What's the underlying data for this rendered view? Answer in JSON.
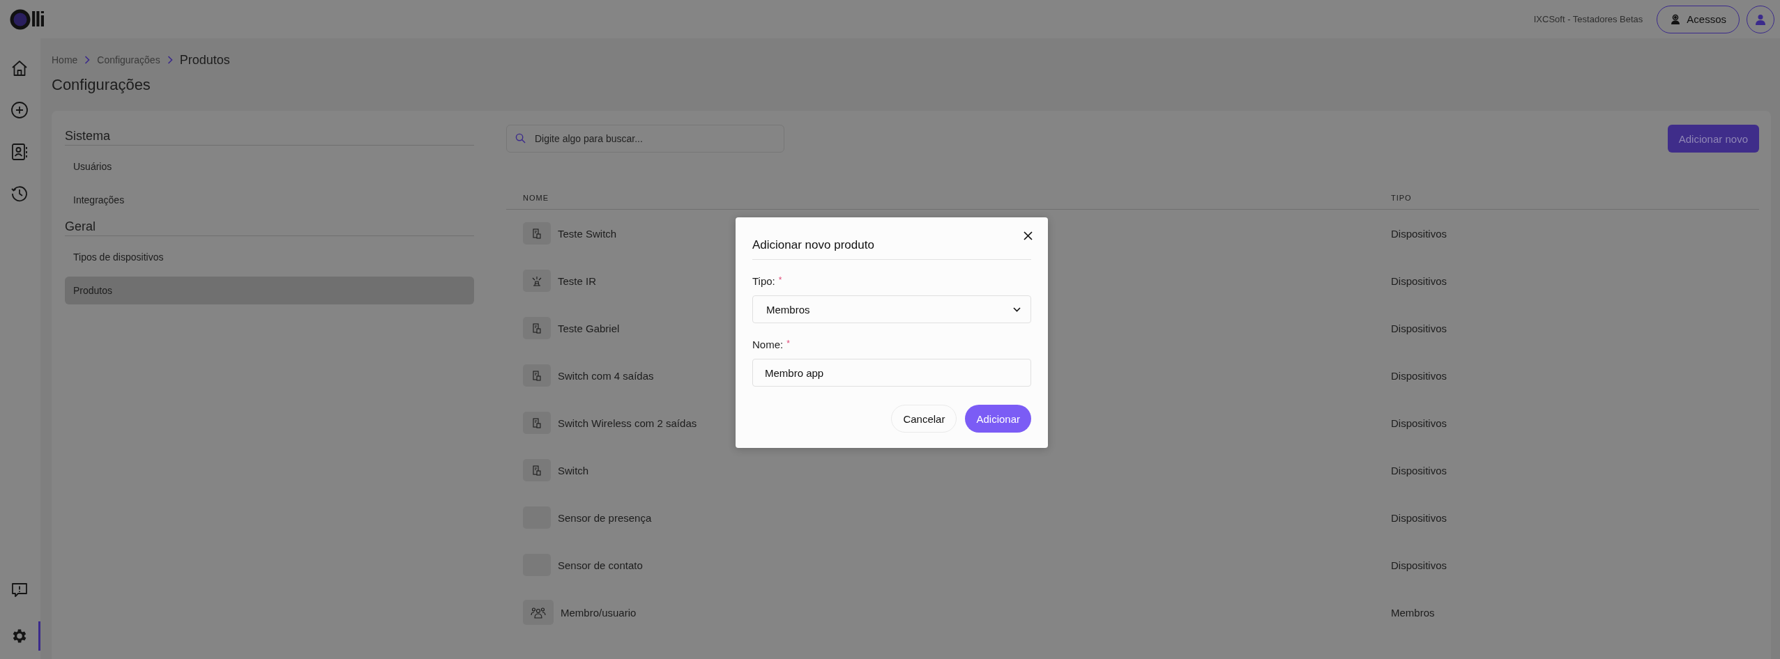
{
  "logo": "lli",
  "top_bar": {
    "organization": "IXCSoft - Testadores Betas",
    "access_button": "Acessos"
  },
  "rail": [
    {
      "kind": "home",
      "selected": false
    },
    {
      "kind": "add",
      "selected": false
    },
    {
      "kind": "contacts",
      "selected": false
    },
    {
      "kind": "history",
      "selected": false
    },
    {
      "kind": "feedback",
      "selected": false
    },
    {
      "kind": "settings",
      "selected": true
    }
  ],
  "breadcrumb": [
    "Home",
    "Configurações",
    "Produtos"
  ],
  "page_title": "Configurações",
  "settings_menu": [
    {
      "title": "Sistema",
      "items": [
        {
          "label": "Usuários",
          "selected": false
        },
        {
          "label": "Integrações",
          "selected": false
        }
      ]
    },
    {
      "title": "Geral",
      "items": [
        {
          "label": "Tipos de dispositivos",
          "selected": false
        },
        {
          "label": "Produtos",
          "selected": true
        }
      ]
    }
  ],
  "search": {
    "placeholder": "Digite algo para buscar..."
  },
  "add_button": "Adicionar novo",
  "table": {
    "columns": [
      "NOME",
      "TIPO"
    ],
    "rows": [
      {
        "kind": "switch",
        "name": "Teste Switch",
        "type": "Dispositivos"
      },
      {
        "kind": "ir",
        "name": "Teste IR",
        "type": "Dispositivos"
      },
      {
        "kind": "switch",
        "name": "Teste Gabriel",
        "type": "Dispositivos"
      },
      {
        "kind": "switch",
        "name": "Switch com 4 saídas",
        "type": "Dispositivos"
      },
      {
        "kind": "switch",
        "name": "Switch Wireless com 2 saídas",
        "type": "Dispositivos"
      },
      {
        "kind": "switch",
        "name": "Switch",
        "type": "Dispositivos"
      },
      {
        "kind": "blank",
        "name": "Sensor de presença",
        "type": "Dispositivos"
      },
      {
        "kind": "blank",
        "name": "Sensor de contato",
        "type": "Dispositivos"
      },
      {
        "kind": "members",
        "name": "Membro/usuario",
        "type": "Membros"
      }
    ]
  },
  "modal": {
    "title": "Adicionar novo produto",
    "fields": [
      {
        "kind": "select",
        "label": "Tipo:",
        "marker": "*",
        "value": "Membros"
      },
      {
        "kind": "text",
        "label": "Nome:",
        "marker": "*",
        "value": "Membro app"
      }
    ],
    "cancel_button": "Cancelar",
    "confirm_button": "Adicionar"
  }
}
